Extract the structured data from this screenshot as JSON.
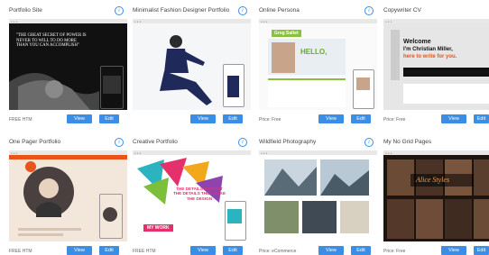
{
  "templates": [
    {
      "title": "Portfolio Site",
      "price": "FREE HTM",
      "view": "View",
      "edit": "Edit",
      "headline": "\"THE GREAT SECRET OF POWER IS NEVER TO WILL TO DO MORE THAN YOU CAN ACCOMPLISH\""
    },
    {
      "title": "Minimalist Fashion Designer Portfolio",
      "price": "",
      "view": "View",
      "edit": "Edit"
    },
    {
      "title": "Online Persona",
      "price": "Price: Free",
      "view": "View",
      "edit": "Edit",
      "hello": "HELLO,",
      "name_tag": "Greg Saltet"
    },
    {
      "title": "Copywriter CV",
      "price": "Price: Free",
      "view": "View",
      "edit": "Edit",
      "welcome_line1": "Welcome",
      "welcome_line2": "I'm Christian Miller,",
      "welcome_line3": "here to write for you."
    },
    {
      "title": "One Pager Portfolio",
      "price": "FREE HTM",
      "view": "View",
      "edit": "Edit"
    },
    {
      "title": "Creative Portfolio",
      "price": "FREE HTM",
      "view": "View",
      "edit": "Edit",
      "banner": "THE DETAILS ARE NOT THE DETAILS THEY MAKE THE DESIGN",
      "ribbon": "MY WORK"
    },
    {
      "title": "Wildfield Photography",
      "price": "Price: eCommerce",
      "view": "View",
      "edit": "Edit"
    },
    {
      "title": "My No Grid Pages",
      "price": "Price: Free",
      "view": "View",
      "edit": "Edit",
      "overlay": "Alice Styles"
    }
  ],
  "icon_names": {
    "info": "info-icon"
  },
  "colors": {
    "button": "#3a8ee6",
    "accent_orange": "#e8541a"
  }
}
